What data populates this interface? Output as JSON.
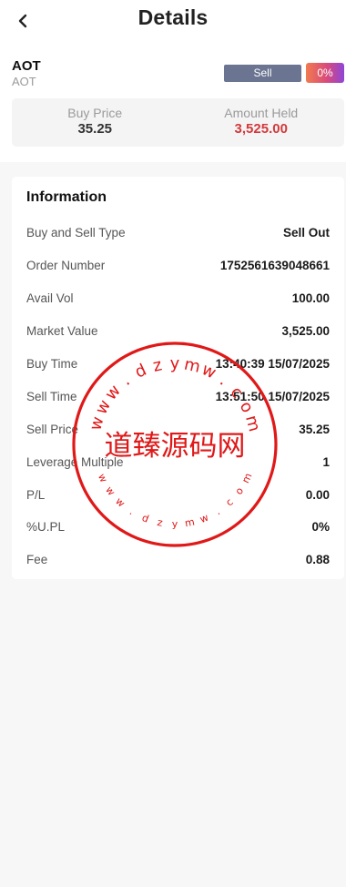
{
  "header": {
    "title": "Details"
  },
  "asset": {
    "symbol": "AOT",
    "subtitle": "AOT",
    "side_label": "Sell",
    "pct_label": "0%"
  },
  "summary": {
    "buy_price_label": "Buy Price",
    "buy_price_value": "35.25",
    "amount_label": "Amount Held",
    "amount_value": "3,525.00"
  },
  "info": {
    "title": "Information",
    "rows": [
      {
        "label": "Buy and Sell Type",
        "value": "Sell Out"
      },
      {
        "label": "Order Number",
        "value": "1752561639048661"
      },
      {
        "label": "Avail Vol",
        "value": "100.00"
      },
      {
        "label": "Market Value",
        "value": "3,525.00"
      },
      {
        "label": "Buy Time",
        "value": "13:40:39 15/07/2025"
      },
      {
        "label": "Sell Time",
        "value": "13:51:50 15/07/2025"
      },
      {
        "label": "Sell Price",
        "value": "35.25"
      },
      {
        "label": "Leverage Multiple",
        "value": "1"
      },
      {
        "label": "P/L",
        "value": "0.00"
      },
      {
        "label": "%U.PL",
        "value": "0%"
      },
      {
        "label": "Fee",
        "value": "0.88"
      }
    ]
  },
  "watermark": {
    "text": "道臻源码网",
    "ring_text": "www.dzymw.com",
    "color": "#e01818"
  },
  "colors": {
    "sell_badge": "#6b7592",
    "loss_red": "#d23a3a"
  },
  "icons": {
    "back": "chevron-left-icon"
  }
}
